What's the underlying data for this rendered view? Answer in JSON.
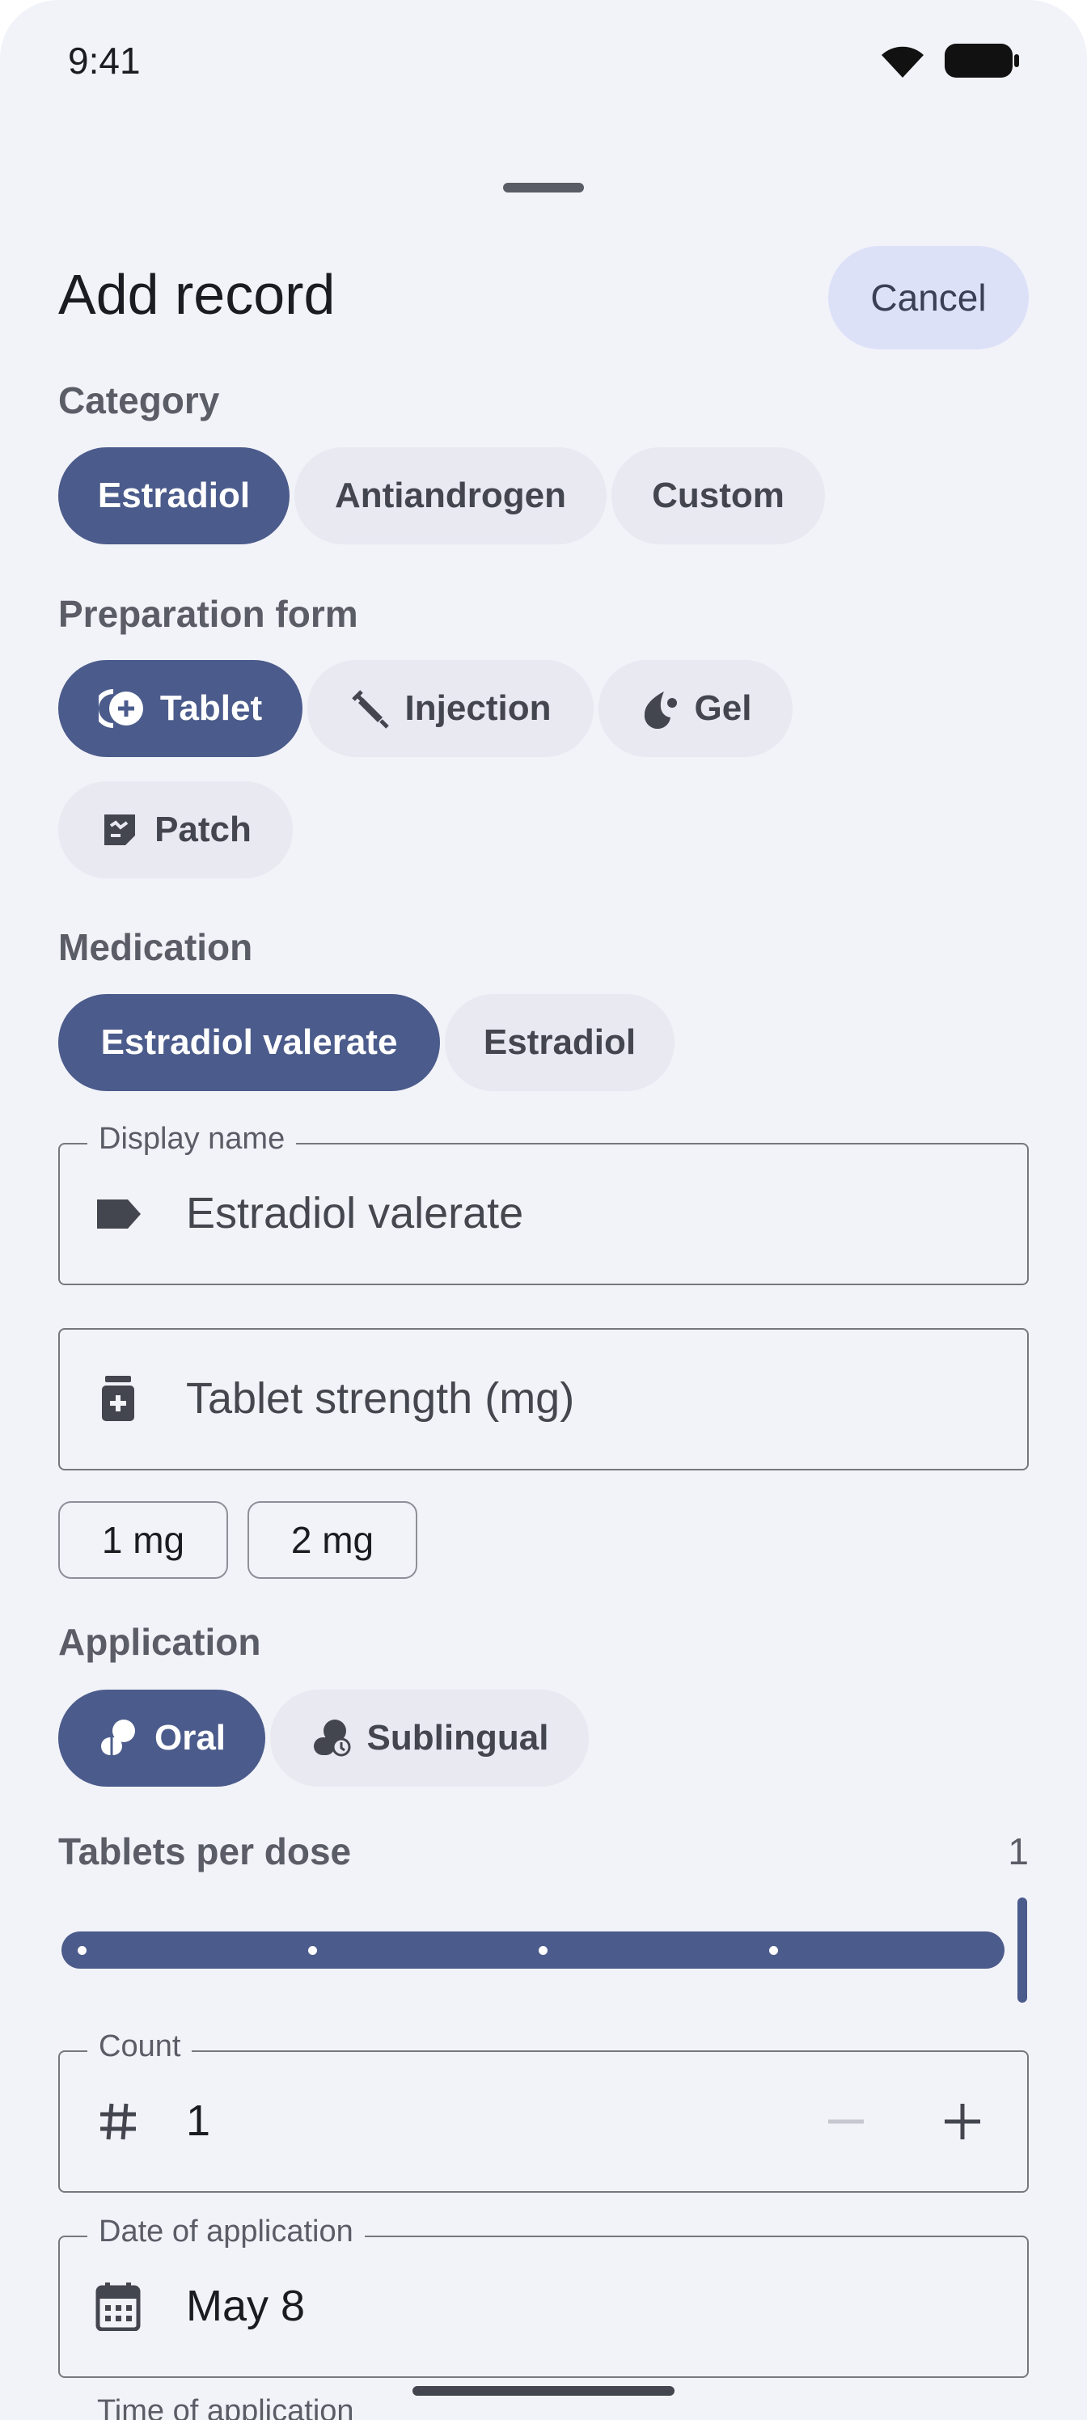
{
  "status_bar": {
    "time": "9:41",
    "icons": [
      "wifi-icon",
      "battery-icon"
    ]
  },
  "sheet": {
    "title": "Add record",
    "cancel_label": "Cancel"
  },
  "category": {
    "label": "Category",
    "options": [
      "Estradiol",
      "Antiandrogen",
      "Custom"
    ],
    "selected": "Estradiol"
  },
  "preparation_form": {
    "label": "Preparation form",
    "options": [
      {
        "label": "Tablet",
        "icon": "tablet-add-icon"
      },
      {
        "label": "Injection",
        "icon": "syringe-icon"
      },
      {
        "label": "Gel",
        "icon": "gel-drop-icon"
      },
      {
        "label": "Patch",
        "icon": "patch-icon"
      }
    ],
    "selected": "Tablet"
  },
  "medication": {
    "label": "Medication",
    "options": [
      "Estradiol valerate",
      "Estradiol"
    ],
    "selected": "Estradiol valerate"
  },
  "display_name": {
    "label": "Display name",
    "value": "Estradiol valerate",
    "icon": "label-tag-icon"
  },
  "tablet_strength": {
    "placeholder": "Tablet strength (mg)",
    "icon": "pill-bottle-icon",
    "presets": [
      "1 mg",
      "2 mg"
    ]
  },
  "application": {
    "label": "Application",
    "options": [
      {
        "label": "Oral",
        "icon": "oral-pills-icon"
      },
      {
        "label": "Sublingual",
        "icon": "sublingual-pills-icon"
      }
    ],
    "selected": "Oral"
  },
  "tablets_per_dose": {
    "label": "Tablets per dose",
    "value": "1",
    "level": 1.0
  },
  "count": {
    "label": "Count",
    "value": "1",
    "icon": "hash-icon"
  },
  "date_of_application": {
    "label": "Date of application",
    "value": "May 8",
    "icon": "calendar-icon"
  },
  "time_of_application": {
    "label": "Time of application"
  },
  "colors": {
    "accent": "#4b5b8b",
    "background": "#f2f3f9",
    "chip": "#e8e9f1",
    "cancel_bg": "#dde1f8"
  }
}
